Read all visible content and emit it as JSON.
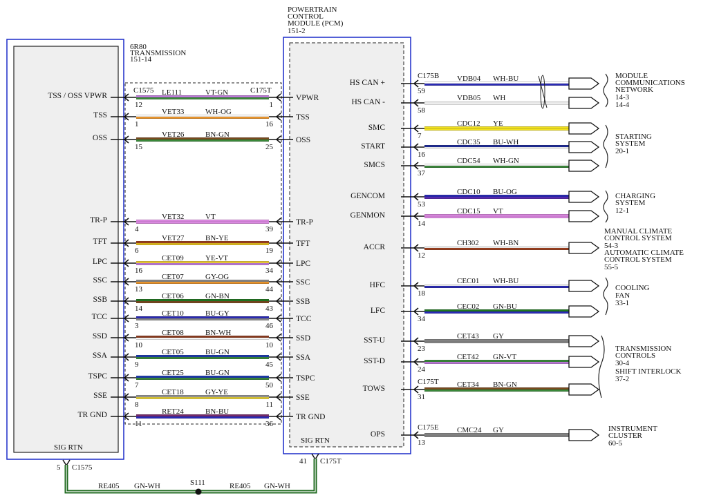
{
  "transmission": {
    "title_lines": [
      "6R80",
      "TRANSMISSION",
      "151-14"
    ],
    "connector": "C1575",
    "sig_rtn_label": "SIG RTN",
    "sig_rtn_pin": "5",
    "sig_rtn_connector": "C1575"
  },
  "pcm": {
    "title_lines": [
      "POWERTRAIN",
      "CONTROL",
      "MODULE (PCM)",
      "151-2"
    ],
    "left_connector": "C175T",
    "sig_rtn_label": "SIG RTN",
    "sig_rtn_pin": "41",
    "sig_rtn_connector": "C175T"
  },
  "splice": {
    "name": "S111",
    "left_circuit": "RE405",
    "left_color": "GN-WH",
    "right_circuit": "RE405",
    "right_color": "GN-WH"
  },
  "left_wires": [
    {
      "tcm_label": "TSS / OSS VPWR",
      "circuit": "LE111",
      "color": "VT-GN",
      "pin_left": "12",
      "pin_right": "1",
      "pcm_label": "VPWR",
      "color1": "#c37de0",
      "color2": "#3a8a3a"
    },
    {
      "tcm_label": "TSS",
      "circuit": "VET33",
      "color": "WH-OG",
      "pin_left": "1",
      "pin_right": "16",
      "pcm_label": "TSS",
      "color1": "#ffffff",
      "color2": "#f39a2c"
    },
    {
      "tcm_label": "OSS",
      "circuit": "VET26",
      "color": "BN-GN",
      "pin_left": "15",
      "pin_right": "25",
      "pcm_label": "OSS",
      "color1": "#7a4a1e",
      "color2": "#3a8a3a"
    },
    {
      "tcm_label": "TR-P",
      "circuit": "VET32",
      "color": "VT",
      "pin_left": "4",
      "pin_right": "39",
      "pcm_label": "TR-P",
      "color1": "#e28be8",
      "color2": "#e28be8"
    },
    {
      "tcm_label": "TFT",
      "circuit": "VET27",
      "color": "BN-YE",
      "pin_left": "6",
      "pin_right": "19",
      "pcm_label": "TFT",
      "color1": "#a0401e",
      "color2": "#e8c21e"
    },
    {
      "tcm_label": "LPC",
      "circuit": "CET09",
      "color": "YE-VT",
      "pin_left": "16",
      "pin_right": "34",
      "pcm_label": "LPC",
      "color1": "#f3d23a",
      "color2": "#c37de0"
    },
    {
      "tcm_label": "SSC",
      "circuit": "CET07",
      "color": "GY-OG",
      "pin_left": "13",
      "pin_right": "44",
      "pcm_label": "SSC",
      "color1": "#8a8a8a",
      "color2": "#f39a2c"
    },
    {
      "tcm_label": "SSB",
      "circuit": "CET06",
      "color": "GN-BN",
      "pin_left": "14",
      "pin_right": "43",
      "pcm_label": "SSB",
      "color1": "#1f7a1f",
      "color2": "#7a4a1e"
    },
    {
      "tcm_label": "TCC",
      "circuit": "CET10",
      "color": "BU-GY",
      "pin_left": "3",
      "pin_right": "46",
      "pcm_label": "TCC",
      "color1": "#2a2ab8",
      "color2": "#8a8a8a"
    },
    {
      "tcm_label": "SSD",
      "circuit": "CET08",
      "color": "BN-WH",
      "pin_left": "10",
      "pin_right": "10",
      "pcm_label": "SSD",
      "color1": "#8a3a1e",
      "color2": "#ffffff"
    },
    {
      "tcm_label": "SSA",
      "circuit": "CET05",
      "color": "BU-GN",
      "pin_left": "9",
      "pin_right": "45",
      "pcm_label": "SSA",
      "color1": "#1c3ab0",
      "color2": "#3a8a3a"
    },
    {
      "tcm_label": "TSPC",
      "circuit": "CET25",
      "color": "BU-GN",
      "pin_left": "7",
      "pin_right": "50",
      "pcm_label": "TSPC",
      "color1": "#1c3ab0",
      "color2": "#3a8a3a"
    },
    {
      "tcm_label": "SSE",
      "circuit": "CET18",
      "color": "GY-YE",
      "pin_left": "8",
      "pin_right": "11",
      "pcm_label": "SSE",
      "color1": "#9a9a9a",
      "color2": "#e8d23a"
    },
    {
      "tcm_label": "TR GND",
      "circuit": "RET24",
      "color": "BN-BU",
      "pin_left": "11",
      "pin_right": "36",
      "pcm_label": "TR GND",
      "color1": "#7a2a6a",
      "color2": "#2a2ab8"
    }
  ],
  "right_wires": [
    {
      "pcm_label": "HS CAN +",
      "connector": "C175B",
      "circuit": "VDB04",
      "color": "WH-BU",
      "pin": "59",
      "color1": "#ffffff",
      "color2": "#2a2ab8"
    },
    {
      "pcm_label": "HS CAN -",
      "connector": "",
      "circuit": "VDB05",
      "color": "WH",
      "pin": "58",
      "color1": "#ffffff",
      "color2": "#ffffff"
    },
    {
      "pcm_label": "SMC",
      "connector": "",
      "circuit": "CDC12",
      "color": "YE",
      "pin": "7",
      "color1": "#f3e21e",
      "color2": "#f3e21e"
    },
    {
      "pcm_label": "START",
      "connector": "",
      "circuit": "CDC35",
      "color": "BU-WH",
      "pin": "16",
      "color1": "#1c2a9a",
      "color2": "#ffffff"
    },
    {
      "pcm_label": "SMCS",
      "connector": "",
      "circuit": "CDC54",
      "color": "WH-GN",
      "pin": "37",
      "color1": "#ffffff",
      "color2": "#3a8a3a"
    },
    {
      "pcm_label": "GENCOM",
      "connector": "",
      "circuit": "CDC10",
      "color": "BU-OG",
      "pin": "53",
      "color1": "#2a2ab8",
      "color2": "#5a2ab8"
    },
    {
      "pcm_label": "GENMON",
      "connector": "",
      "circuit": "CDC15",
      "color": "VT",
      "pin": "14",
      "color1": "#e28be8",
      "color2": "#e28be8"
    },
    {
      "pcm_label": "ACCR",
      "connector": "",
      "circuit": "CH302",
      "color": "WH-BN",
      "pin": "12",
      "color1": "#ffffff",
      "color2": "#a0401e"
    },
    {
      "pcm_label": "HFC",
      "connector": "",
      "circuit": "CEC01",
      "color": "WH-BU",
      "pin": "18",
      "color1": "#ffffff",
      "color2": "#2a2ab8"
    },
    {
      "pcm_label": "LFC",
      "connector": "",
      "circuit": "CEC02",
      "color": "GN-BU",
      "pin": "34",
      "color1": "#1f7a1f",
      "color2": "#2a2ab8"
    },
    {
      "pcm_label": "SST-U",
      "connector": "",
      "circuit": "CET43",
      "color": "GY",
      "pin": "23",
      "color1": "#8a8a8a",
      "color2": "#8a8a8a"
    },
    {
      "pcm_label": "SST-D",
      "connector": "",
      "circuit": "CET42",
      "color": "GN-VT",
      "pin": "24",
      "color1": "#3a8a3a",
      "color2": "#c37de0"
    },
    {
      "pcm_label": "TOWS",
      "connector": "C175T",
      "circuit": "CET34",
      "color": "BN-GN",
      "pin": "31",
      "color1": "#7a4a1e",
      "color2": "#3a8a3a"
    },
    {
      "pcm_label": "OPS",
      "connector": "C175E",
      "circuit": "CMC24",
      "color": "GY",
      "pin": "13",
      "color1": "#8a8a8a",
      "color2": "#8a8a8a"
    }
  ],
  "destinations": [
    {
      "lines": [
        "MODULE",
        "COMMUNICATIONS",
        "NETWORK",
        "14-3",
        "14-4"
      ]
    },
    {
      "lines": [
        "STARTING",
        "SYSTEM",
        "20-1"
      ]
    },
    {
      "lines": [
        "CHARGING",
        "SYSTEM",
        "12-1"
      ]
    },
    {
      "lines": [
        "MANUAL CLIMATE",
        "CONTROL SYSTEM",
        "54-3",
        "AUTOMATIC CLIMATE",
        "CONTROL SYSTEM",
        "55-5"
      ]
    },
    {
      "lines": [
        "COOLING",
        "FAN",
        "33-1"
      ]
    },
    {
      "lines": [
        "TRANSMISSION",
        "CONTROLS",
        "30-4",
        "SHIFT INTERLOCK",
        "37-2"
      ]
    },
    {
      "lines": [
        "INSTRUMENT",
        "CLUSTER",
        "60-5"
      ]
    }
  ]
}
